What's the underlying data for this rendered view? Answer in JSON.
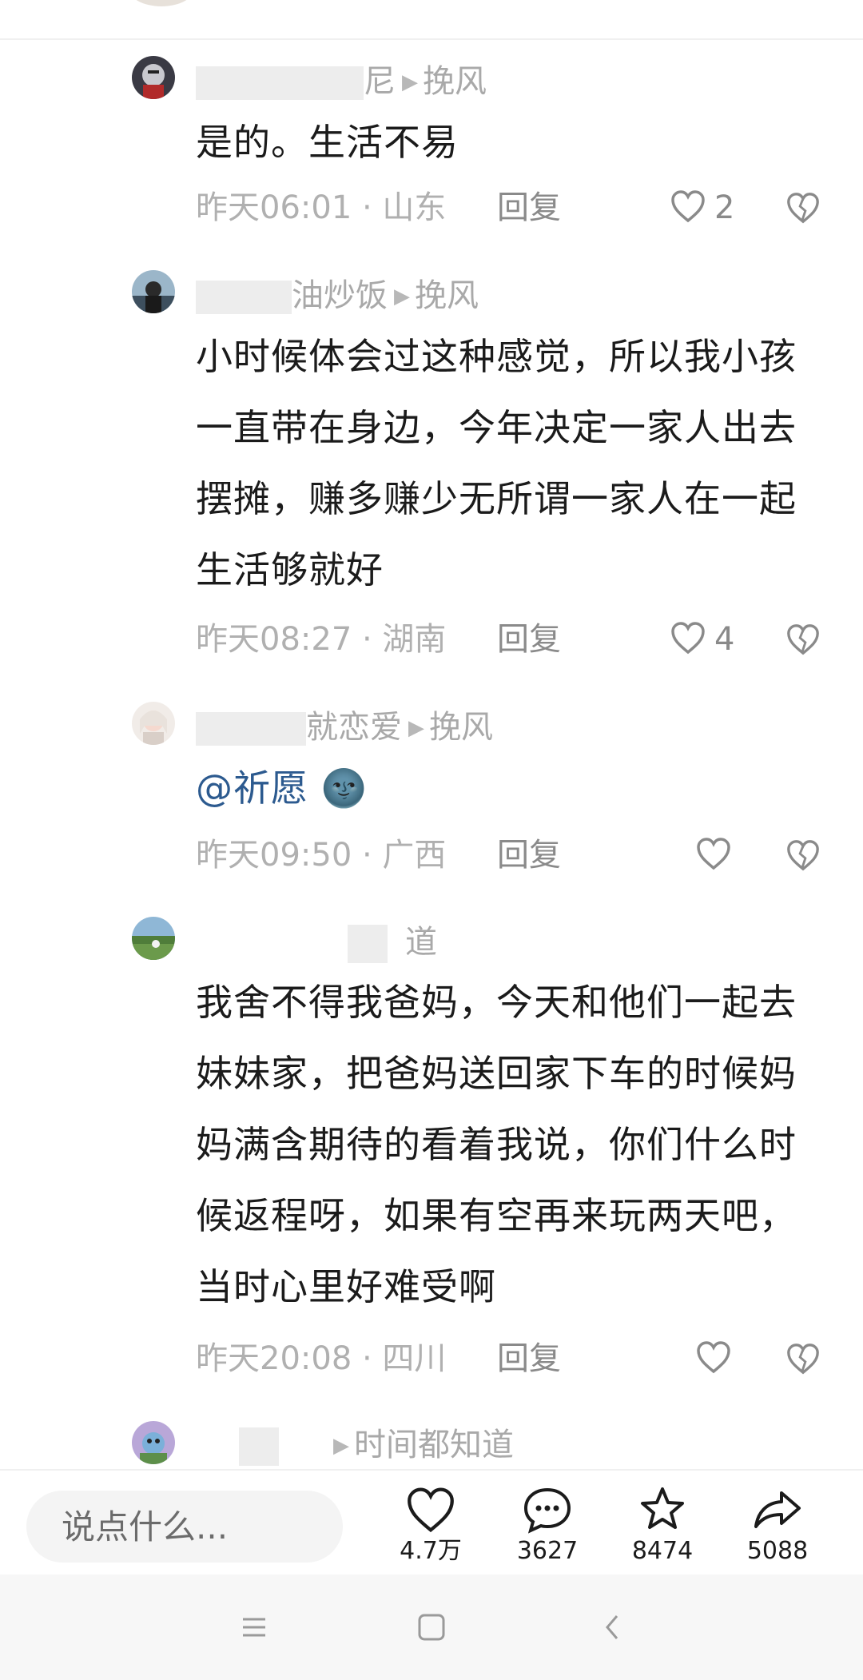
{
  "comments": [
    {
      "author_tail": "尼",
      "reply_to": "挽风",
      "text": "是的。生活不易",
      "time": "昨天06:01 · 山东",
      "reply_label": "回复",
      "likes": "2"
    },
    {
      "author_tail": "油炒饭",
      "reply_to": "挽风",
      "text": "小时候体会过这种感觉，所以我小孩一直带在身边，今年决定一家人出去摆摊，赚多赚少无所谓一家人在一起生活够就好",
      "time": "昨天08:27 · 湖南",
      "reply_label": "回复",
      "likes": "4"
    },
    {
      "author_tail": "就恋爱",
      "reply_to": "挽风",
      "mention": "@祈愿",
      "emoji": "🌚",
      "time": "昨天09:50 · 广西",
      "reply_label": "回复",
      "likes": ""
    },
    {
      "author_tail": "道",
      "text": "我舍不得我爸妈，今天和他们一起去妹妹家，把爸妈送回家下车的时候妈妈满含期待的看着我说，你们什么时候返程呀，如果有空再来玩两天吧，当时心里好难受啊",
      "time": "昨天20:08 · 四川",
      "reply_label": "回复",
      "likes": ""
    },
    {
      "reply_to": "时间都知道"
    }
  ],
  "bottom_bar": {
    "input_placeholder": "说点什么...",
    "like_count": "4.7万",
    "comment_count": "3627",
    "star_count": "8474",
    "share_count": "5088"
  },
  "icons": {
    "like": "heart-icon",
    "dislike": "broken-heart-icon",
    "comment": "comment-bubble-icon",
    "star": "star-icon",
    "share": "share-arrow-icon",
    "nav_menu": "menu-lines-icon",
    "nav_home": "square-home-icon",
    "nav_back": "back-chevron-icon"
  }
}
